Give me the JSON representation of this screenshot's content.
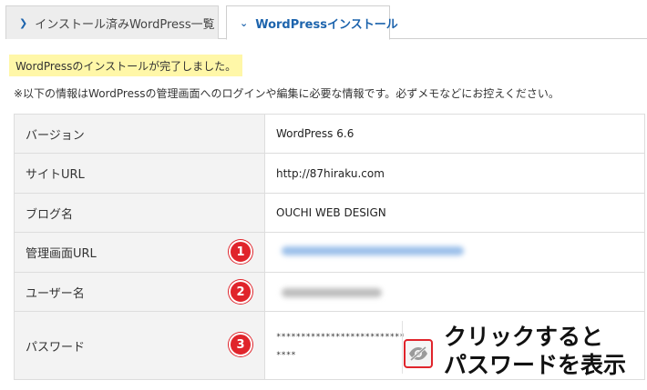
{
  "tabs": [
    {
      "label": "インストール済みWordPress一覧",
      "active": false
    },
    {
      "label": "WordPressインストール",
      "active": true
    }
  ],
  "notice": "WordPressのインストールが完了しました。",
  "info": "※以下の情報はWordPressの管理画面へのログインや編集に必要な情報です。必ずメモなどにお控えください。",
  "table": {
    "rows": [
      {
        "label": "バージョン",
        "value": "WordPress 6.6"
      },
      {
        "label": "サイトURL",
        "value": "http://87hiraku.com"
      },
      {
        "label": "ブログ名",
        "value": "OUCHI WEB DESIGN"
      },
      {
        "label": "管理画面URL",
        "value": "",
        "blurred": true
      },
      {
        "label": "ユーザー名",
        "value": "",
        "blurred": true
      },
      {
        "label": "パスワード",
        "value": "******************************"
      }
    ]
  },
  "markers": [
    "1",
    "2",
    "3"
  ],
  "callout": {
    "line1": "クリックすると",
    "line2": "パスワードを表示"
  },
  "icons": {
    "tab_chevron": "chevron-right-icon",
    "active_chevron": "chevron-down-icon",
    "password_toggle": "eye-slash-icon"
  },
  "colors": {
    "accent": "#1d64ad",
    "notice_bg": "#fff7a8",
    "marker": "#e0242b"
  }
}
